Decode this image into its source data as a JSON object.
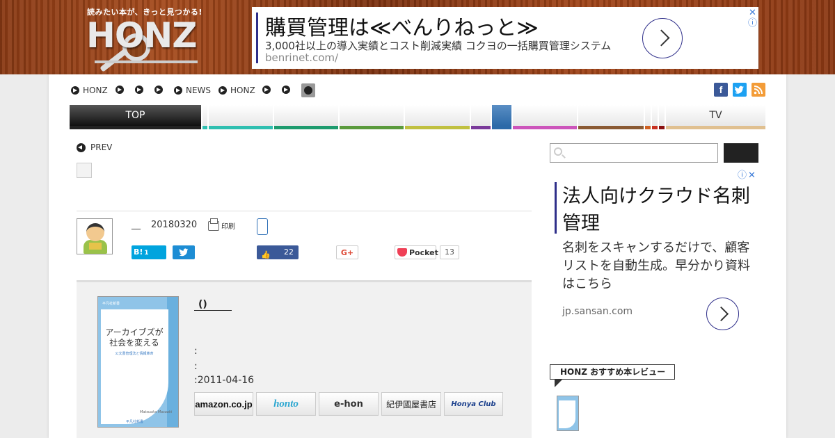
{
  "header": {
    "logo_tagline": "読みたい本が、きっと見つかる!",
    "logo_word": "HONZ"
  },
  "top_ad": {
    "headline": "購買管理は≪べんりねっと≫",
    "description": "3,000社以上の導入実績とコスト削減実績 コクヨの一括購買管理システム",
    "domain": "benrinet.com/",
    "info_icon": "ⓘ",
    "close_icon": "✕"
  },
  "breadcrumb": {
    "items": [
      "HONZ",
      "",
      "",
      "",
      "NEWS",
      "HONZ",
      "",
      ""
    ]
  },
  "social": {
    "facebook": "f",
    "twitter": "t",
    "rss": "rss"
  },
  "nav": {
    "tabs": [
      {
        "label": "TOP",
        "color": "#222222"
      },
      {
        "label": "",
        "color": "#2fbfb0"
      },
      {
        "label": "",
        "color": "#1d9b6e"
      },
      {
        "label": "",
        "color": "#5a9a3c"
      },
      {
        "label": "",
        "color": "#c0c040"
      },
      {
        "label": "",
        "color": "#7a3a9a"
      },
      {
        "label": "",
        "color": "#2c6aa8"
      },
      {
        "label": "",
        "color": "#cc55bb"
      },
      {
        "label": "",
        "color": "#8a5a33"
      },
      {
        "label": "",
        "color": "#d06020"
      },
      {
        "label": "",
        "color": "#c83020"
      },
      {
        "label": "",
        "color": "#8a1010"
      },
      {
        "label": "TV",
        "color": "#e0c090"
      }
    ]
  },
  "article": {
    "prev_label": "PREV",
    "author_line": "__",
    "date": "20180320",
    "print_label": "印刷"
  },
  "share": {
    "hatena_label": "B!",
    "hatena_count": "1",
    "facebook_count": "22",
    "googleplus_label": "G+",
    "pocket_label": "Pocket",
    "pocket_count": "13"
  },
  "book": {
    "title": "()",
    "meta_1": ":",
    "meta_2": ":",
    "meta_3": ":2011-04-16",
    "cover": {
      "title": "アーカイブズが社会を変える",
      "subtitle": "公文書管理法と情報革命",
      "author_roman": "Matsuoka Masaaki",
      "series": "平凡社新書",
      "imprint": "平凡社新書"
    },
    "stores": {
      "amazon": "amazon.co.jp",
      "honto": "honto",
      "ehon": "e-hon",
      "kinokuniya": "紀伊國屋書店",
      "honyaclub": "Honya Club"
    }
  },
  "sidebar": {
    "ad": {
      "headline": "法人向けクラウド名刺管理",
      "body": "名刺をスキャンするだけで、顧客リストを自動生成。早分かり資料はこちら",
      "domain": "jp.sansan.com",
      "info_icon": "ⓘ",
      "close_icon": "✕"
    },
    "recommend_label": "HONZ おすすめ本レビュー"
  }
}
